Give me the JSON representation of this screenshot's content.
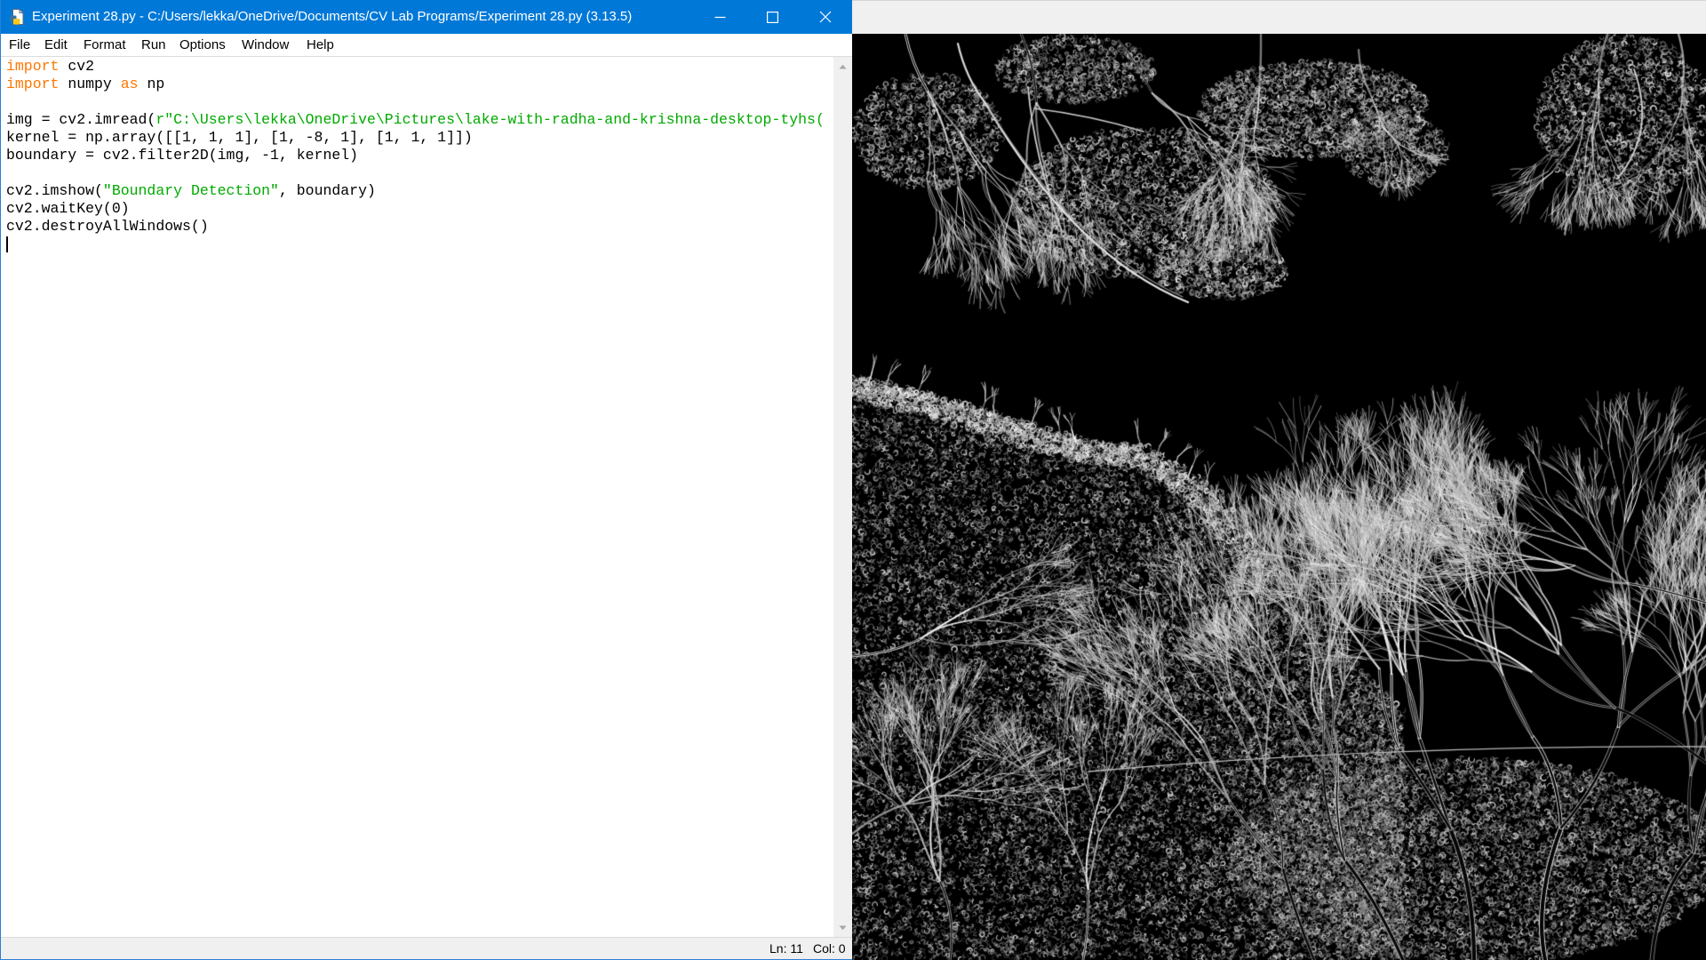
{
  "editor_window": {
    "title": "Experiment 28.py - C:/Users/lekka/OneDrive/Documents/CV Lab Programs/Experiment 28.py (3.13.5)",
    "icon": "idle-file-icon",
    "window_controls": {
      "minimize": "minimize-icon",
      "maximize": "maximize-icon",
      "close": "close-icon"
    },
    "menu": [
      "File",
      "Edit",
      "Format",
      "Run",
      "Options",
      "Window",
      "Help"
    ],
    "code": [
      [
        {
          "text": "import",
          "color": "#ff7700"
        },
        {
          "text": " cv2",
          "color": "#000000"
        }
      ],
      [
        {
          "text": "import",
          "color": "#ff7700"
        },
        {
          "text": " numpy ",
          "color": "#000000"
        },
        {
          "text": "as",
          "color": "#ff7700"
        },
        {
          "text": " np",
          "color": "#000000"
        }
      ],
      [],
      [
        {
          "text": "img = cv2.imread(",
          "color": "#000000"
        },
        {
          "text": "r\"C:\\Users\\lekka\\OneDrive\\Pictures\\lake-with-radha-and-krishna-desktop-tyhs(",
          "color": "#00aa00"
        }
      ],
      [
        {
          "text": "kernel = np.array([[1, 1, 1], [1, -8, 1], [1, 1, 1]])",
          "color": "#000000"
        }
      ],
      [
        {
          "text": "boundary = cv2.filter2D(img, -1, kernel)",
          "color": "#000000"
        }
      ],
      [],
      [
        {
          "text": "cv2.imshow(",
          "color": "#000000"
        },
        {
          "text": "\"Boundary Detection\"",
          "color": "#00aa00"
        },
        {
          "text": ", boundary)",
          "color": "#000000"
        }
      ],
      [
        {
          "text": "cv2.waitKey(0)",
          "color": "#000000"
        }
      ],
      [
        {
          "text": "cv2.destroyAllWindows()",
          "color": "#000000"
        }
      ],
      []
    ],
    "status": {
      "line": "Ln: 11",
      "column": "Col: 0"
    }
  },
  "colors": {
    "title_bar": "#0078d7",
    "keyword": "#ff7700",
    "string": "#00aa00",
    "image_background": "#000000"
  }
}
